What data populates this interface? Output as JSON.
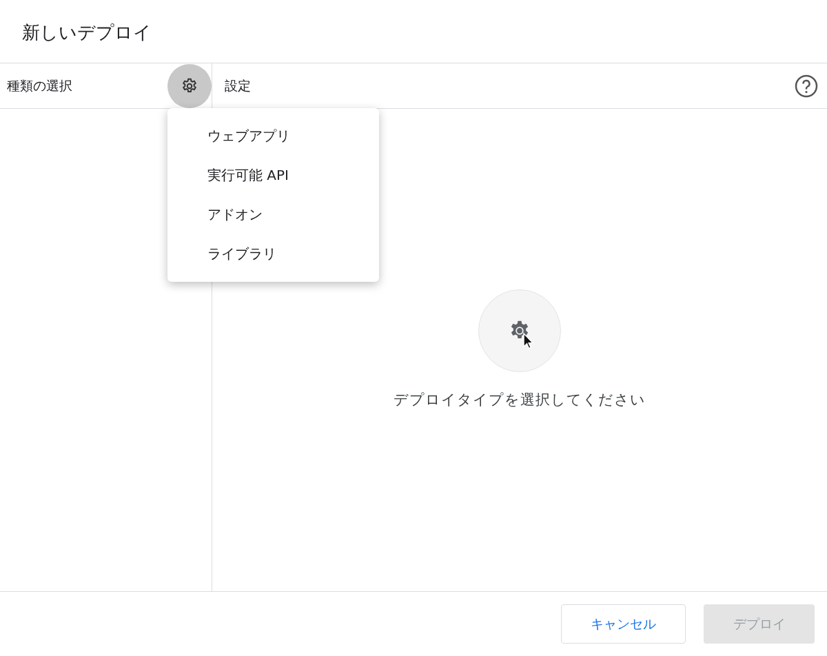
{
  "dialog": {
    "title": "新しいデプロイ"
  },
  "type_panel": {
    "header": "種類の選択",
    "type_menu": {
      "expanded": true,
      "items": [
        {
          "label": "ウェブアプリ"
        },
        {
          "label": "実行可能 API"
        },
        {
          "label": "アドオン"
        },
        {
          "label": "ライブラリ"
        }
      ]
    }
  },
  "settings_panel": {
    "header": "設定",
    "empty_message": "デプロイタイプを選択してください"
  },
  "buttons": [
    {
      "label": "キャンセル",
      "kind": "secondary",
      "disabled": false
    },
    {
      "label": "デプロイ",
      "kind": "primary",
      "disabled": true
    }
  ]
}
